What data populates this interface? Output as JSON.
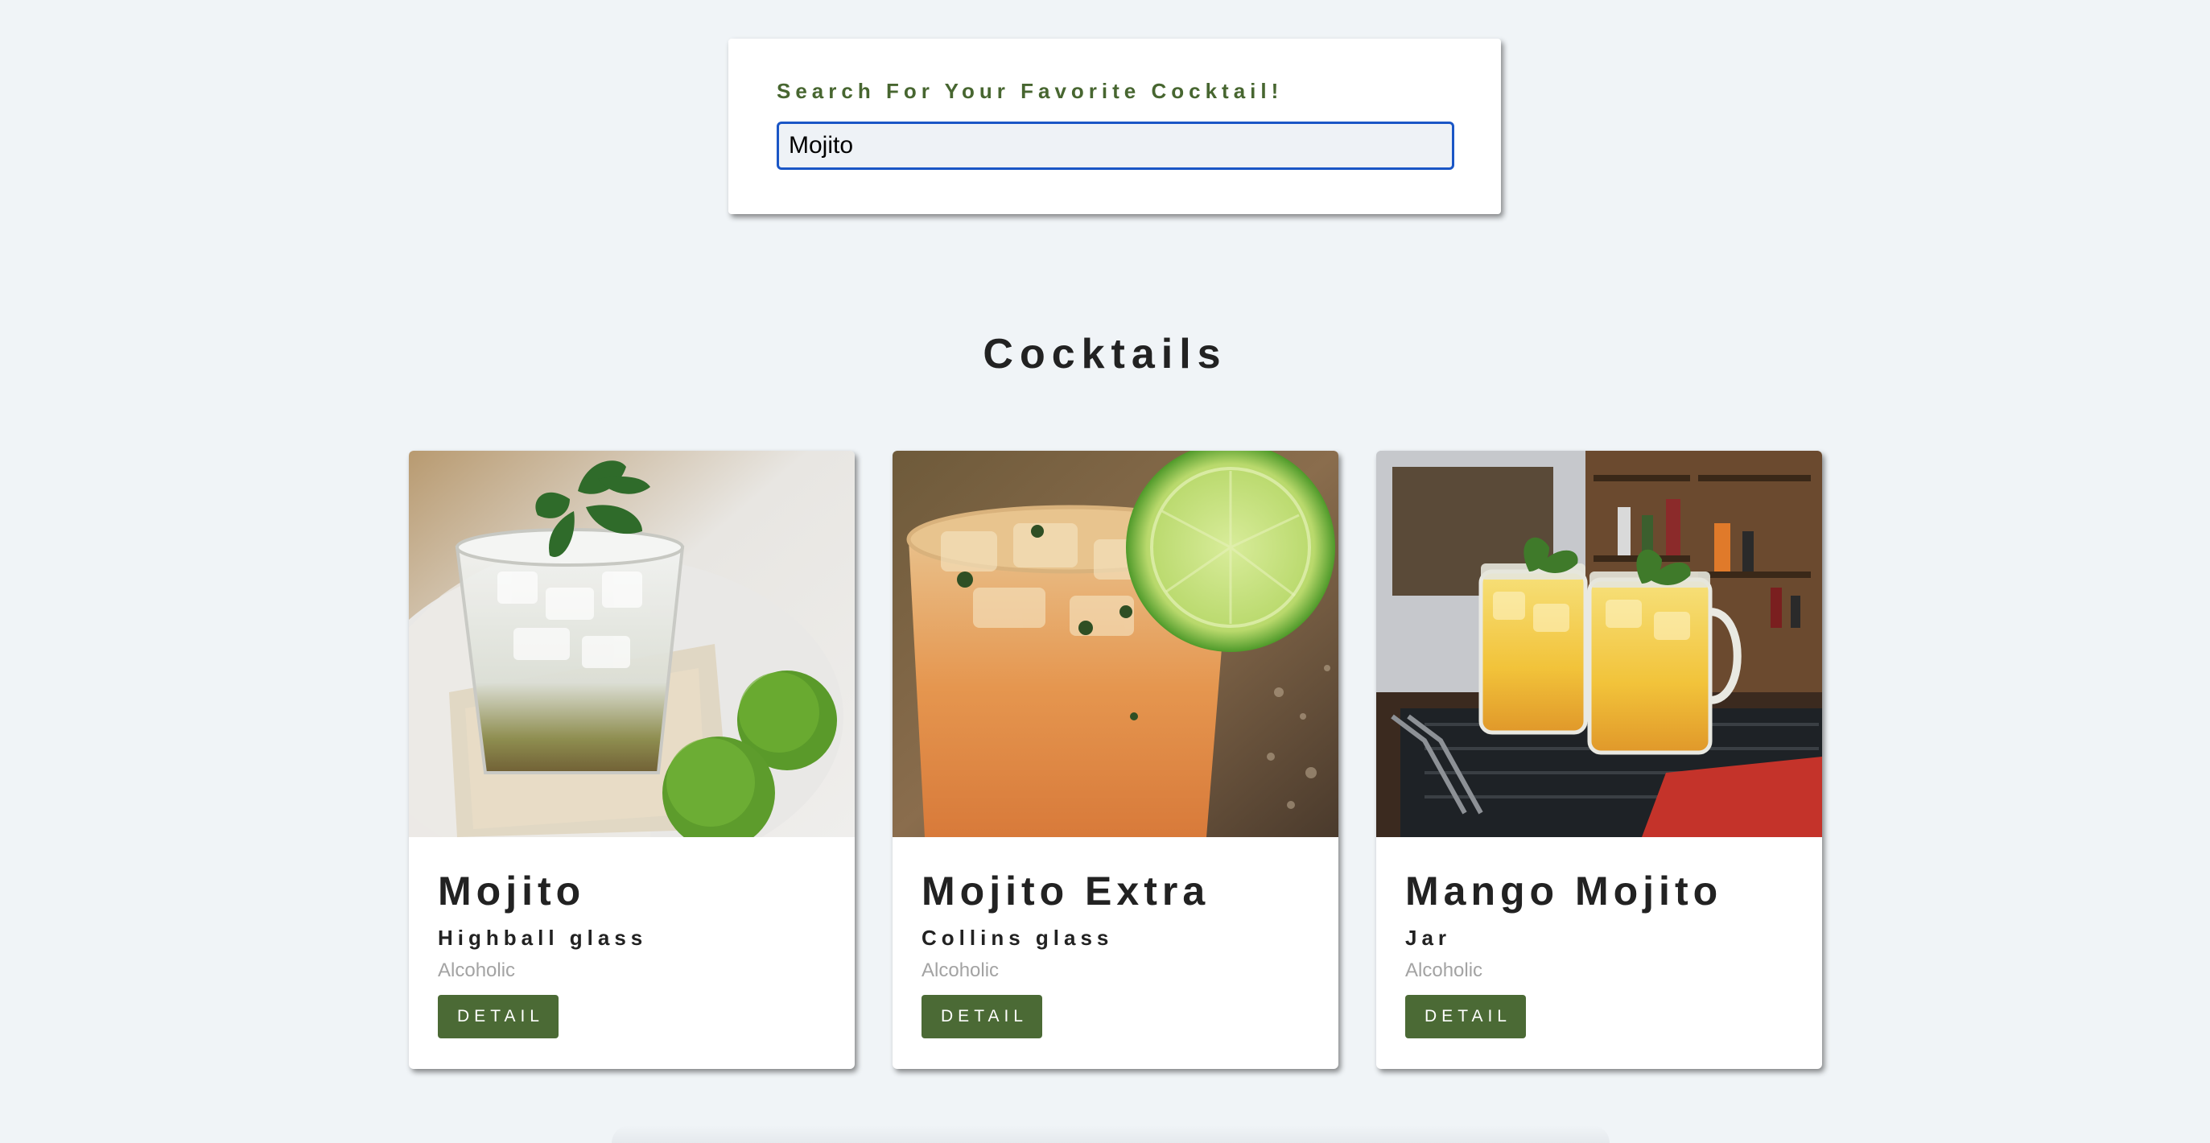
{
  "search": {
    "label": "Search For Your Favorite Cocktail!",
    "value": "Mojito",
    "accent_color": "#476630",
    "focus_color": "#1a56c6"
  },
  "section": {
    "title": "Cocktails"
  },
  "cards": [
    {
      "name": "Mojito",
      "glass": "Highball glass",
      "type": "Alcoholic",
      "button_label": "DETAIL",
      "image": "mojito-photo"
    },
    {
      "name": "Mojito Extra",
      "glass": "Collins glass",
      "type": "Alcoholic",
      "button_label": "DETAIL",
      "image": "mojito-extra-photo"
    },
    {
      "name": "Mango Mojito",
      "glass": "Jar",
      "type": "Alcoholic",
      "button_label": "DETAIL",
      "image": "mango-mojito-photo"
    }
  ],
  "colors": {
    "background": "#f0f4f7",
    "button": "#4b6a35",
    "muted_text": "#a3a3a3"
  }
}
